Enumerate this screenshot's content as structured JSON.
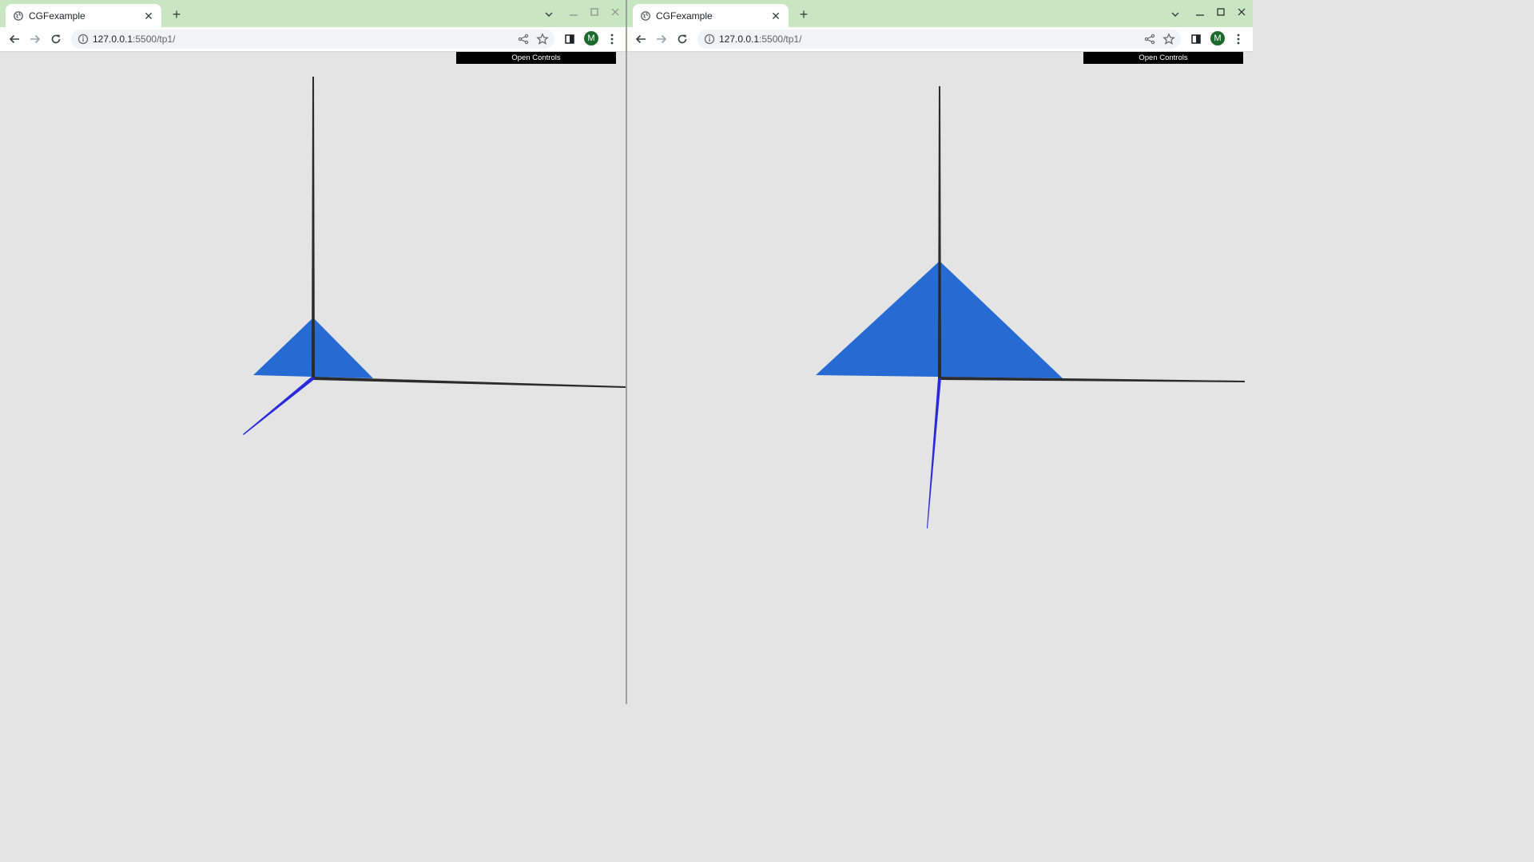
{
  "windows": [
    {
      "tab_title": "CGFexample",
      "tab_close": "✕",
      "new_tab": "+",
      "url_host": "127.0.0.1",
      "url_rest": ":5500/tp1/",
      "avatar_letter": "M",
      "controls_label": "Open Controls"
    },
    {
      "tab_title": "CGFexample",
      "tab_close": "✕",
      "new_tab": "+",
      "url_host": "127.0.0.1",
      "url_rest": ":5500/tp1/",
      "avatar_letter": "M",
      "controls_label": "Open Controls"
    }
  ],
  "colors": {
    "titlebar": "#c8e6c1",
    "canvas_bg": "#e4e4e4",
    "triangle": "#266bd4",
    "axis": "#2b2b2b",
    "z_axis": "#2a2add",
    "avatar": "#1e6a2e"
  }
}
